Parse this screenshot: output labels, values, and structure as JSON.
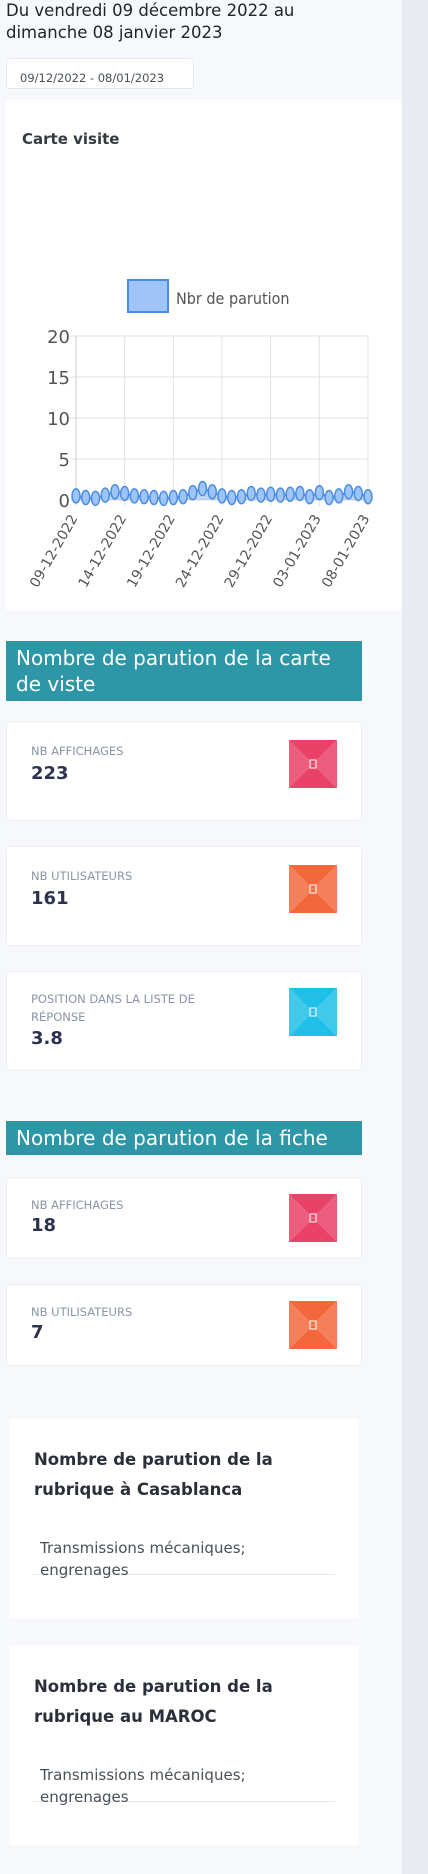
{
  "header": {
    "period_text": "Du vendredi 09 décembre 2022 au dimanche 08 janvier 2023",
    "date_range_value": "09/12/2022 - 08/01/2023"
  },
  "chart_card": {
    "title": "Carte visite"
  },
  "chart_data": {
    "type": "line",
    "x_tick_labels": [
      "09-12-2022",
      "14-12-2022",
      "19-12-2022",
      "24-12-2022",
      "29-12-2022",
      "03-01-2023",
      "08-01-2023"
    ],
    "x": [
      "09-12-2022",
      "10-12-2022",
      "11-12-2022",
      "12-12-2022",
      "13-12-2022",
      "14-12-2022",
      "15-12-2022",
      "16-12-2022",
      "17-12-2022",
      "18-12-2022",
      "19-12-2022",
      "20-12-2022",
      "21-12-2022",
      "22-12-2022",
      "23-12-2022",
      "24-12-2022",
      "25-12-2022",
      "26-12-2022",
      "27-12-2022",
      "28-12-2022",
      "29-12-2022",
      "30-12-2022",
      "31-12-2022",
      "01-01-2023",
      "02-01-2023",
      "03-01-2023",
      "04-01-2023",
      "05-01-2023",
      "06-01-2023",
      "07-01-2023",
      "08-01-2023"
    ],
    "series": [
      {
        "name": "Nbr de parution",
        "values": [
          0.5,
          0.3,
          0.2,
          0.6,
          1,
          0.8,
          0.5,
          0.4,
          0.3,
          0.2,
          0.3,
          0.4,
          0.9,
          1.4,
          1,
          0.5,
          0.3,
          0.4,
          0.8,
          0.6,
          0.7,
          0.6,
          0.7,
          0.8,
          0.4,
          0.9,
          0.3,
          0.5,
          1,
          0.8,
          0.4
        ]
      }
    ],
    "ylim": [
      0,
      20
    ],
    "y_ticks": [
      0,
      5,
      10,
      15,
      20
    ],
    "grid": true,
    "legend": "top",
    "colors": {
      "line": "#4a8de6",
      "fill": "rgba(74,141,230,0.35)",
      "legend_box": "#9fc5f8"
    }
  },
  "section_carte": {
    "title": "Nombre de parution de la carte de viste",
    "stats": [
      {
        "label": "NB AFFICHAGES",
        "value": "223",
        "icon": "display-icon",
        "color": "#e94167"
      },
      {
        "label": "NB UTILISATEURS",
        "value": "161",
        "icon": "users-icon",
        "color": "#f2683c"
      },
      {
        "label": "POSITION DANS LA LISTE DE RÉPONSE",
        "value": "3.8",
        "icon": "position-icon",
        "color": "#20c0e8"
      }
    ]
  },
  "section_fiche": {
    "title": "Nombre de parution de la fiche",
    "stats": [
      {
        "label": "NB AFFICHAGES",
        "value": "18",
        "icon": "display-icon",
        "color": "#e94167"
      },
      {
        "label": "NB UTILISATEURS",
        "value": "7",
        "icon": "users-icon",
        "color": "#f2683c"
      }
    ]
  },
  "rubric_casablanca": {
    "title": "Nombre de parution de la rubrique à Casablanca",
    "items": [
      "Transmissions mécaniques; engrenages"
    ]
  },
  "rubric_maroc": {
    "title": "Nombre de parution de la rubrique au MAROC",
    "items": [
      "Transmissions mécaniques; engrenages"
    ]
  }
}
